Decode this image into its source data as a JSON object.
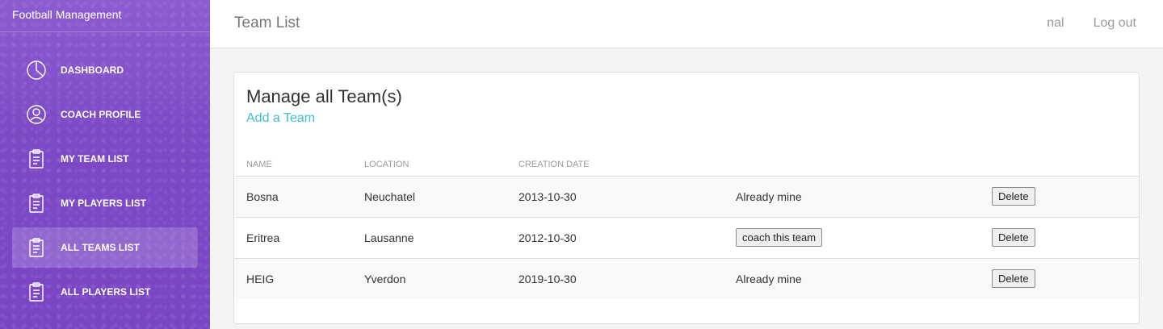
{
  "app": {
    "title": "Football Management"
  },
  "sidebar": {
    "items": [
      {
        "label": "DASHBOARD",
        "icon": "pie-chart-icon",
        "active": false
      },
      {
        "label": "COACH PROFILE",
        "icon": "user-icon",
        "active": false
      },
      {
        "label": "MY TEAM LIST",
        "icon": "clipboard-icon",
        "active": false
      },
      {
        "label": "MY PLAYERS LIST",
        "icon": "clipboard-icon",
        "active": false
      },
      {
        "label": "ALL TEAMS LIST",
        "icon": "clipboard-icon",
        "active": true
      },
      {
        "label": "ALL PLAYERS LIST",
        "icon": "clipboard-icon",
        "active": false
      }
    ]
  },
  "header": {
    "title": "Team List",
    "user": "nal",
    "logout": "Log out"
  },
  "card": {
    "title": "Manage all Team(s)",
    "add_link": "Add a Team"
  },
  "table": {
    "columns": [
      "NAME",
      "LOCATION",
      "CREATION DATE",
      "",
      ""
    ],
    "rows": [
      {
        "name": "Bosna",
        "location": "Neuchatel",
        "date": "2013-10-30",
        "status": "Already mine",
        "status_is_button": false,
        "action": "Delete"
      },
      {
        "name": "Eritrea",
        "location": "Lausanne",
        "date": "2012-10-30",
        "status": "coach this team",
        "status_is_button": true,
        "action": "Delete"
      },
      {
        "name": "HEIG",
        "location": "Yverdon",
        "date": "2019-10-30",
        "status": "Already mine",
        "status_is_button": false,
        "action": "Delete"
      }
    ]
  },
  "colors": {
    "sidebar": "#7d4ac6",
    "link": "#3bbfd4"
  }
}
